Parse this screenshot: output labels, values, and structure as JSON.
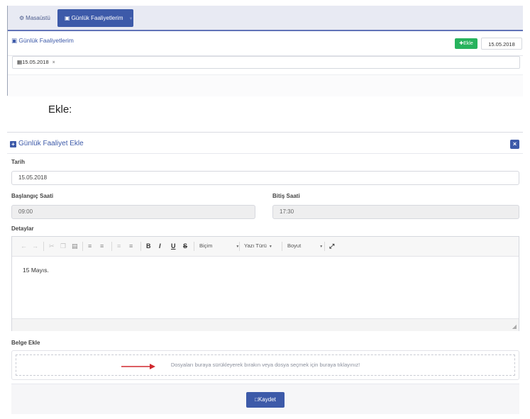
{
  "top": {
    "tabs": [
      {
        "label": "Masaüstü",
        "icon": "dashboard-icon"
      },
      {
        "label": "Günlük Faaliyetlerim",
        "icon": "briefcase-icon"
      }
    ],
    "panel_title": "Günlük Faaliyetlerim",
    "add_button": "Ekle",
    "date_value": "15.05.2018",
    "filter_tag": "15.05.2018",
    "filter_remove": "×"
  },
  "caption": "Ekle:",
  "modal": {
    "title": "Günlük Faaliyet Ekle",
    "close_label": "×",
    "tarih_label": "Tarih",
    "tarih_value": "15.05.2018",
    "baslangic_label": "Başlangıç Saati",
    "baslangic_value": "09:00",
    "bitis_label": "Bitiş Saati",
    "bitis_value": "17:30",
    "detaylar_label": "Detaylar",
    "toolbar": {
      "format_select": "Biçim",
      "font_select": "Yazı Türü",
      "size_select": "Boyut"
    },
    "editor_content": "15 Mayıs.",
    "belge_label": "Belge Ekle",
    "dropzone_text": "Dosyaları buraya sürükleyerek bırakın veya dosya seçmek için buraya tıklayınız!",
    "save_label": "Kaydet"
  },
  "colors": {
    "primary": "#3d5aa9",
    "success": "#27b35d",
    "annotation_arrow": "#d0282e"
  }
}
